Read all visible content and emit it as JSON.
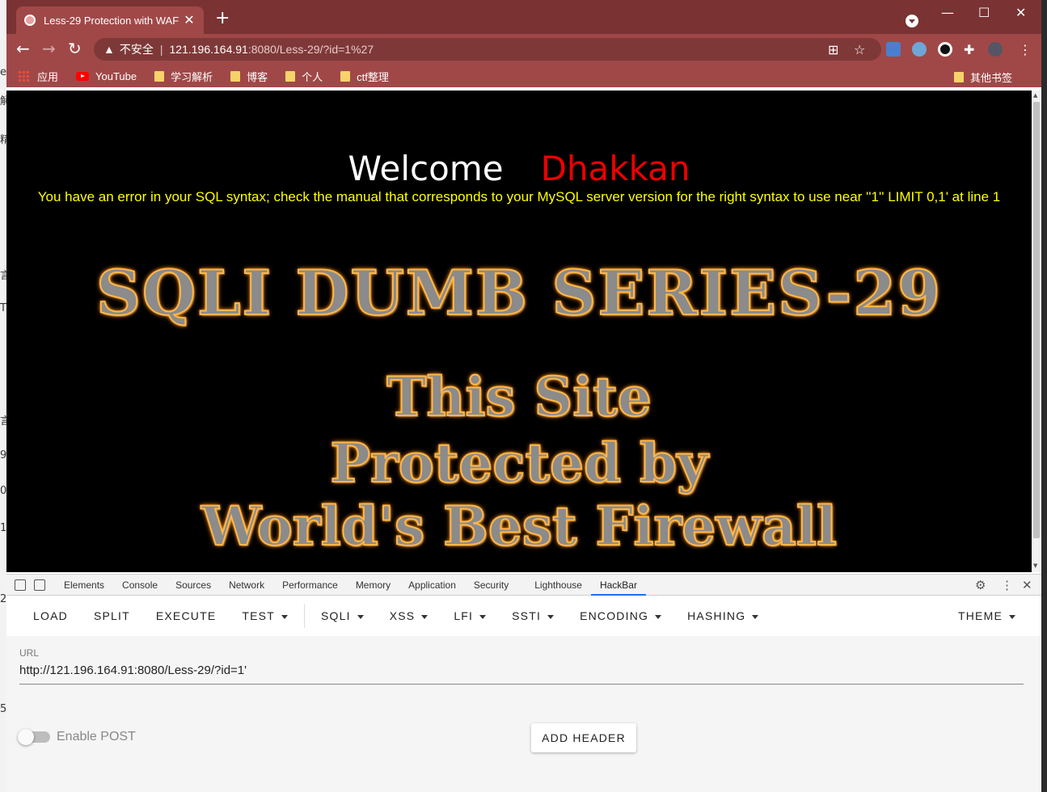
{
  "browser": {
    "tab_title": "Less-29 Protection with WAF",
    "tab_close": "✕",
    "new_tab": "+",
    "window_controls": {
      "minimize": "—",
      "maximize": "☐",
      "close": "✕"
    },
    "url_security_label": "不安全",
    "url_host": "121.196.164.91",
    "url_path": ":8080/Less-29/?id=1%27",
    "bookmarks": [
      "应用",
      "YouTube",
      "学习解析",
      "博客",
      "个人",
      "ctf整理"
    ],
    "bookmarks_other": "其他书签",
    "accent_color": "#a04848"
  },
  "page": {
    "welcome": "Welcome",
    "username": "Dhakkan",
    "sql_error": "You have an error in your SQL syntax; check the manual that corresponds to your MySQL server version for the right syntax to use near ''1'' LIMIT 0,1' at line 1",
    "banner_title": "SQLI DUMB SERIES-29",
    "banner_lines": [
      "This Site",
      "Protected by",
      "World's Best Firewall"
    ]
  },
  "devtools": {
    "tabs": [
      "Elements",
      "Console",
      "Sources",
      "Network",
      "Performance",
      "Memory",
      "Application",
      "Security",
      "Lighthouse",
      "HackBar"
    ],
    "active_tab": "HackBar"
  },
  "hackbar": {
    "menu": [
      "LOAD",
      "SPLIT",
      "EXECUTE",
      "TEST",
      "SQLI",
      "XSS",
      "LFI",
      "SSTI",
      "ENCODING",
      "HASHING",
      "THEME"
    ],
    "url_label": "URL",
    "url_value": "http://121.196.164.91:8080/Less-29/?id=1'",
    "enable_post_label": "Enable POST",
    "enable_post": false,
    "add_header_label": "ADD HEADER"
  },
  "background_window_chars": [
    "e",
    "解",
    "精",
    "言",
    "T",
    "言",
    "9",
    "0",
    "1",
    "2",
    "5"
  ]
}
